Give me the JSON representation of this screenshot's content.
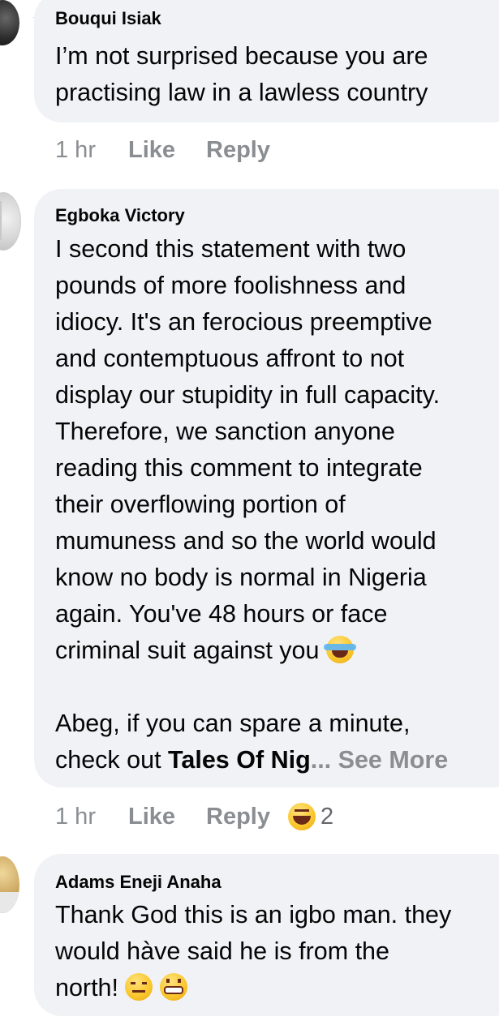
{
  "comments": [
    {
      "author": "Bouqui Isiak",
      "lines": [
        "I’m not surprised because you are",
        "practising law in a lawless country"
      ],
      "time": "1 hr",
      "like": "Like",
      "reply": "Reply"
    },
    {
      "author": "Egboka Victory",
      "lines": [
        "I second this statement with two",
        "pounds of more foolishness and",
        "idiocy. It's an ferocious preemptive",
        "and contemptuous affront to not",
        "display our stupidity in full capacity.",
        "Therefore, we sanction anyone",
        "reading this comment to integrate",
        "their overflowing portion of",
        "mumuness and so the world would",
        "know no body is normal in Nigeria",
        "again. You've 48 hours or face",
        "criminal suit against you"
      ],
      "line_after_gap": "Abeg, if you can spare a minute,",
      "last_line_prefix": "check out ",
      "last_line_bold": "Tales Of Nig",
      "see_more": "... See More",
      "time": "1 hr",
      "like": "Like",
      "reply": "Reply",
      "reaction_count": "2"
    },
    {
      "author": "Adams Eneji Anaha",
      "lines": [
        "Thank God this is an igbo man. they",
        "would hàve said he is from the",
        "north!"
      ]
    }
  ]
}
